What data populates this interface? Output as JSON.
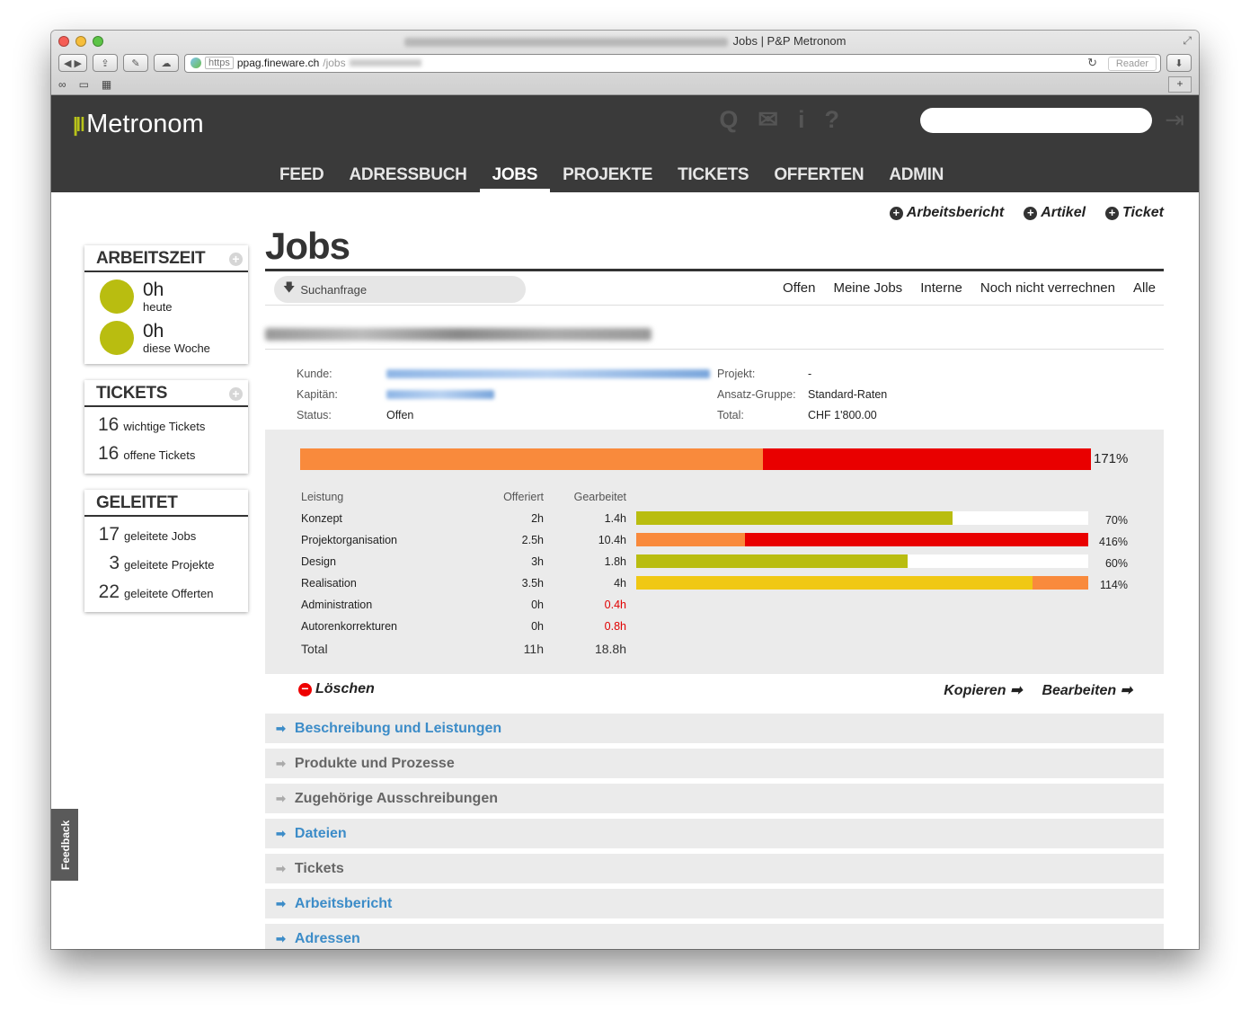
{
  "browser": {
    "title": "Jobs | P&P Metronom",
    "url_scheme": "https",
    "url_host": "ppag.fineware.ch",
    "url_path": "/jobs",
    "reader_label": "Reader"
  },
  "app": {
    "logo": "Metronom",
    "nav": [
      "FEED",
      "ADRESSBUCH",
      "JOBS",
      "PROJEKTE",
      "TICKETS",
      "OFFERTEN",
      "ADMIN"
    ],
    "active_nav": "JOBS"
  },
  "top_actions": {
    "arbeitsbericht": "Arbeitsbericht",
    "artikel": "Artikel",
    "ticket": "Ticket"
  },
  "sidebar": {
    "arbeitszeit": {
      "title": "ARBEITSZEIT",
      "today_value": "0h",
      "today_label": "heute",
      "week_value": "0h",
      "week_label": "diese Woche",
      "dot_color": "#b9bd10"
    },
    "tickets": {
      "title": "TICKETS",
      "items": [
        {
          "num": "16",
          "label": "wichtige Tickets"
        },
        {
          "num": "16",
          "label": "offene Tickets"
        }
      ]
    },
    "geleitet": {
      "title": "GELEITET",
      "items": [
        {
          "num": "17",
          "label": "geleitete Jobs"
        },
        {
          "num": "3",
          "label": "geleitete Projekte"
        },
        {
          "num": "22",
          "label": "geleitete Offerten"
        }
      ]
    },
    "feedback": "Feedback"
  },
  "page": {
    "title": "Jobs",
    "search_label": "Suchanfrage",
    "filters": [
      "Offen",
      "Meine Jobs",
      "Interne",
      "Noch nicht verrechnen",
      "Alle"
    ]
  },
  "job": {
    "kunde_label": "Kunde:",
    "kapitaen_label": "Kapitän:",
    "status_label": "Status:",
    "status_value": "Offen",
    "projekt_label": "Projekt:",
    "projekt_value": "-",
    "ansatz_label": "Ansatz-Gruppe:",
    "ansatz_value": "Standard-Raten",
    "total_label": "Total:",
    "total_value": "CHF 1'800.00"
  },
  "performance": {
    "total_percent_label": "171%",
    "total_percent": 1.71,
    "colors": {
      "green": "#b9bd10",
      "orange": "#f98a3c",
      "red": "#e90000",
      "yellow": "#f0c814"
    },
    "headers": {
      "leistung": "Leistung",
      "offeriert": "Offeriert",
      "gearbeitet": "Gearbeitet"
    },
    "rows": [
      {
        "name": "Konzept",
        "offeriert": "2h",
        "gearbeitet": "1.4h",
        "pct_label": "70%",
        "ratio": 0.7,
        "type": "green",
        "over": false
      },
      {
        "name": "Projektorganisation",
        "offeriert": "2.5h",
        "gearbeitet": "10.4h",
        "pct_label": "416%",
        "ratio": 4.16,
        "type": "red",
        "over": false
      },
      {
        "name": "Design",
        "offeriert": "3h",
        "gearbeitet": "1.8h",
        "pct_label": "60%",
        "ratio": 0.6,
        "type": "green",
        "over": false
      },
      {
        "name": "Realisation",
        "offeriert": "3.5h",
        "gearbeitet": "4h",
        "pct_label": "114%",
        "ratio": 1.14,
        "type": "yellow",
        "over": false
      },
      {
        "name": "Administration",
        "offeriert": "0h",
        "gearbeitet": "0.4h",
        "pct_label": "",
        "ratio": 0,
        "type": "none",
        "over": true
      },
      {
        "name": "Autorenkorrekturen",
        "offeriert": "0h",
        "gearbeitet": "0.8h",
        "pct_label": "",
        "ratio": 0,
        "type": "none",
        "over": true
      }
    ],
    "total": {
      "name": "Total",
      "offeriert": "11h",
      "gearbeitet": "18.8h"
    }
  },
  "row_actions": {
    "delete": "Löschen",
    "copy": "Kopieren",
    "edit": "Bearbeiten"
  },
  "sections": [
    {
      "label": "Beschreibung und Leistungen",
      "active": true
    },
    {
      "label": "Produkte und Prozesse",
      "active": false
    },
    {
      "label": "Zugehörige Ausschreibungen",
      "active": false
    },
    {
      "label": "Dateien",
      "active": true
    },
    {
      "label": "Tickets",
      "active": false
    },
    {
      "label": "Arbeitsbericht",
      "active": true
    },
    {
      "label": "Adressen",
      "active": true
    }
  ]
}
